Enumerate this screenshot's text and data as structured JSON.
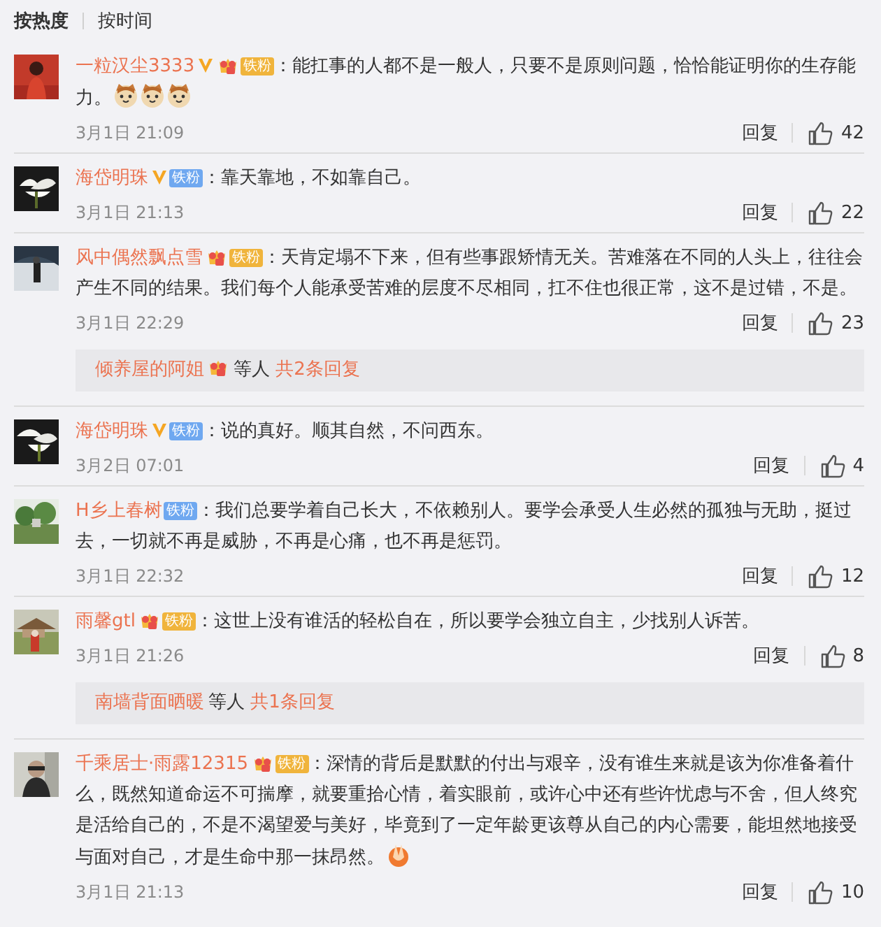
{
  "sort_tabs": [
    {
      "label": "按热度",
      "selected": true
    },
    {
      "label": "按时间",
      "selected": false
    }
  ],
  "comments": [
    {
      "user": {
        "name": "一粒汉尘3333",
        "verified": true,
        "crown": true,
        "fan_badge": {
          "label": "铁粉",
          "kind": "gold"
        }
      },
      "text": "：能扛事的人都不是一般人，只要不是原则问题，恰恰能证明你的生存能力。",
      "emojis": [
        {
          "kind": "cat"
        },
        {
          "kind": "cat"
        },
        {
          "kind": "cat"
        }
      ],
      "time": "3月1日 21:09",
      "reply_label": "回复",
      "likes": "42"
    },
    {
      "user": {
        "name": "海岱明珠",
        "verified": true,
        "crown": false,
        "fan_badge": {
          "label": "铁粉",
          "kind": "blue"
        }
      },
      "text": "：靠天靠地，不如靠自己。",
      "time": "3月1日 21:13",
      "reply_label": "回复",
      "likes": "22"
    },
    {
      "user": {
        "name": "风中偶然飘点雪",
        "verified": false,
        "crown": true,
        "fan_badge": {
          "label": "铁粉",
          "kind": "gold"
        }
      },
      "text": "：天肯定塌不下来，但有些事跟矫情无关。苦难落在不同的人头上，往往会产生不同的结果。我们每个人能承受苦难的层度不尽相同，扛不住也很正常，这不是过错，不是。",
      "time": "3月1日 22:29",
      "reply_label": "回复",
      "likes": "23",
      "replies": {
        "name": "倾养屋的阿姐",
        "crown": true,
        "suffix": "等人",
        "count": "共2条回复"
      }
    },
    {
      "user": {
        "name": "海岱明珠",
        "verified": true,
        "crown": false,
        "fan_badge": {
          "label": "铁粉",
          "kind": "blue"
        }
      },
      "text": "：说的真好。顺其自然，不问西东。",
      "time": "3月2日 07:01",
      "reply_label": "回复",
      "likes": "4"
    },
    {
      "user": {
        "name": "H乡上春树",
        "verified": false,
        "crown": false,
        "fan_badge": {
          "label": "铁粉",
          "kind": "blue"
        }
      },
      "text": "：我们总要学着自己长大，不依赖别人。要学会承受人生必然的孤独与无助，挺过去，一切就不再是威胁，不再是心痛，也不再是惩罚。",
      "time": "3月1日 22:32",
      "reply_label": "回复",
      "likes": "12"
    },
    {
      "user": {
        "name": "雨馨gtl",
        "verified": false,
        "crown": true,
        "fan_badge": {
          "label": "铁粉",
          "kind": "gold"
        }
      },
      "text": "：这世上没有谁活的轻松自在，所以要学会独立自主，少找别人诉苦。",
      "time": "3月1日 21:26",
      "reply_label": "回复",
      "likes": "8",
      "replies": {
        "name": "南墙背面晒暖",
        "crown": false,
        "suffix": "等人",
        "count": "共1条回复"
      }
    },
    {
      "user": {
        "name": "千乘居士·雨露12315",
        "verified": false,
        "crown": true,
        "fan_badge": {
          "label": "铁粉",
          "kind": "gold"
        }
      },
      "text": "：深情的背后是默默的付出与艰辛，没有谁生来就是该为你准备着什么，既然知道命运不可揣摩，就要重拾心情，着实眼前，或许心中还有些许忧虑与不舍，但人终究是活给自己的，不是不渴望爱与美好，毕竟到了一定年龄更该尊从自己的内心需要，能坦然地接受与面对自己，才是生命中那一抹昂然。",
      "emojis": [
        {
          "kind": "hands"
        }
      ],
      "time": "3月1日 21:13",
      "reply_label": "回复",
      "likes": "10"
    }
  ]
}
